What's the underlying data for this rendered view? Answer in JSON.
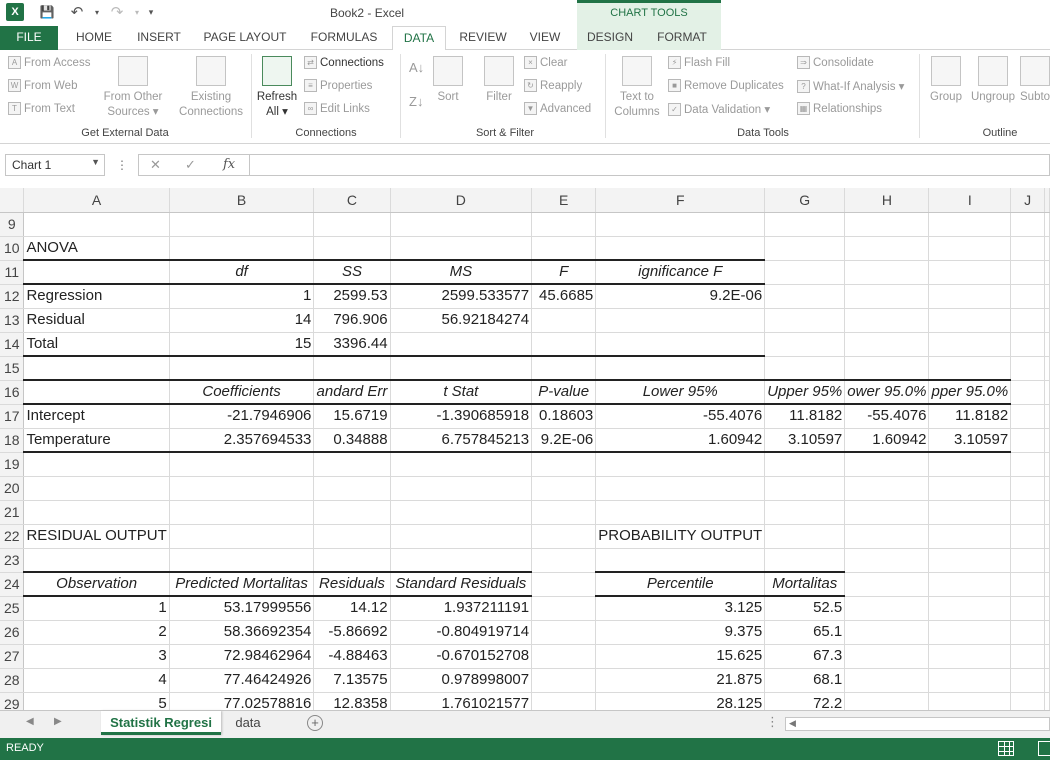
{
  "window": {
    "title": "Book2 - Excel",
    "chart_tools": "CHART TOOLS"
  },
  "tabs": {
    "file": "FILE",
    "home": "HOME",
    "insert": "INSERT",
    "page_layout": "PAGE LAYOUT",
    "formulas": "FORMULAS",
    "data": "DATA",
    "review": "REVIEW",
    "view": "VIEW",
    "design": "DESIGN",
    "format": "FORMAT"
  },
  "ribbon": {
    "get_external": {
      "from_access": "From Access",
      "from_web": "From Web",
      "from_text": "From Text",
      "from_other_1": "From Other",
      "from_other_2": "Sources ▾",
      "existing_1": "Existing",
      "existing_2": "Connections",
      "label": "Get External Data"
    },
    "connections": {
      "refresh_1": "Refresh",
      "refresh_2": "All ▾",
      "connections": "Connections",
      "properties": "Properties",
      "edit_links": "Edit Links",
      "label": "Connections"
    },
    "sort_filter": {
      "sort": "Sort",
      "filter": "Filter",
      "clear": "Clear",
      "reapply": "Reapply",
      "advanced": "Advanced",
      "label": "Sort & Filter"
    },
    "data_tools": {
      "text_to_1": "Text to",
      "text_to_2": "Columns",
      "flash_fill": "Flash Fill",
      "remove_dup": "Remove Duplicates",
      "data_val": "Data Validation ▾",
      "consolidate": "Consolidate",
      "what_if": "What-If Analysis ▾",
      "relationships": "Relationships",
      "label": "Data Tools"
    },
    "outline": {
      "group": "Group",
      "ungroup": "Ungroup",
      "subtotal": "Subto",
      "label": "Outline"
    }
  },
  "formula_bar": {
    "name_box": "Chart 1",
    "fx": "fx",
    "value": ""
  },
  "columns": [
    "A",
    "B",
    "C",
    "D",
    "E",
    "F",
    "G",
    "H",
    "I",
    "J"
  ],
  "rows": [
    {
      "n": "9",
      "cells": [
        "",
        "",
        "",
        "",
        "",
        "",
        "",
        "",
        "",
        ""
      ]
    },
    {
      "n": "10",
      "cells": [
        "ANOVA",
        "",
        "",
        "",
        "",
        "",
        "",
        "",
        "",
        ""
      ]
    },
    {
      "n": "11",
      "cells": [
        "",
        "df",
        "SS",
        "MS",
        "F",
        "ignificance F",
        "",
        "",
        "",
        ""
      ]
    },
    {
      "n": "12",
      "cells": [
        "Regression",
        "1",
        "2599.53",
        "2599.533577",
        "45.6685",
        "9.2E-06",
        "",
        "",
        "",
        ""
      ]
    },
    {
      "n": "13",
      "cells": [
        "Residual",
        "14",
        "796.906",
        "56.92184274",
        "",
        "",
        "",
        "",
        "",
        ""
      ]
    },
    {
      "n": "14",
      "cells": [
        "Total",
        "15",
        "3396.44",
        "",
        "",
        "",
        "",
        "",
        "",
        ""
      ]
    },
    {
      "n": "15",
      "cells": [
        "",
        "",
        "",
        "",
        "",
        "",
        "",
        "",
        "",
        ""
      ]
    },
    {
      "n": "16",
      "cells": [
        "",
        "Coefficients",
        "andard Err",
        "t Stat",
        "P-value",
        "Lower 95%",
        "Upper 95%",
        "ower 95.0%",
        "pper 95.0%",
        ""
      ]
    },
    {
      "n": "17",
      "cells": [
        "Intercept",
        "-21.7946906",
        "15.6719",
        "-1.390685918",
        "0.18603",
        "-55.4076",
        "11.8182",
        "-55.4076",
        "11.8182",
        ""
      ]
    },
    {
      "n": "18",
      "cells": [
        "Temperature",
        "2.357694533",
        "0.34888",
        "6.757845213",
        "9.2E-06",
        "1.60942",
        "3.10597",
        "1.60942",
        "3.10597",
        ""
      ]
    },
    {
      "n": "19",
      "cells": [
        "",
        "",
        "",
        "",
        "",
        "",
        "",
        "",
        "",
        ""
      ]
    },
    {
      "n": "20",
      "cells": [
        "",
        "",
        "",
        "",
        "",
        "",
        "",
        "",
        "",
        ""
      ]
    },
    {
      "n": "21",
      "cells": [
        "",
        "",
        "",
        "",
        "",
        "",
        "",
        "",
        "",
        ""
      ]
    },
    {
      "n": "22",
      "cells": [
        "RESIDUAL OUTPUT",
        "",
        "",
        "",
        "",
        "PROBABILITY OUTPUT",
        "",
        "",
        "",
        ""
      ]
    },
    {
      "n": "23",
      "cells": [
        "",
        "",
        "",
        "",
        "",
        "",
        "",
        "",
        "",
        ""
      ]
    },
    {
      "n": "24",
      "cells": [
        "Observation",
        "Predicted Mortalitas",
        "Residuals",
        "Standard Residuals",
        "",
        "Percentile",
        "Mortalitas",
        "",
        "",
        ""
      ]
    },
    {
      "n": "25",
      "cells": [
        "1",
        "53.17999556",
        "14.12",
        "1.937211191",
        "",
        "3.125",
        "52.5",
        "",
        "",
        ""
      ]
    },
    {
      "n": "26",
      "cells": [
        "2",
        "58.36692354",
        "-5.86692",
        "-0.804919714",
        "",
        "9.375",
        "65.1",
        "",
        "",
        ""
      ]
    },
    {
      "n": "27",
      "cells": [
        "3",
        "72.98462964",
        "-4.88463",
        "-0.670152708",
        "",
        "15.625",
        "67.3",
        "",
        "",
        ""
      ]
    },
    {
      "n": "28",
      "cells": [
        "4",
        "77.46424926",
        "7.13575",
        "0.978998007",
        "",
        "21.875",
        "68.1",
        "",
        "",
        ""
      ]
    },
    {
      "n": "29",
      "cells": [
        "5",
        "77.02578816",
        "12.8358",
        "1.761021577",
        "",
        "28.125",
        "72.2",
        "",
        "",
        ""
      ]
    }
  ],
  "sheets": {
    "active": "Statistik Regresi",
    "other": "data",
    "add": "+"
  },
  "status": {
    "text": "READY"
  }
}
